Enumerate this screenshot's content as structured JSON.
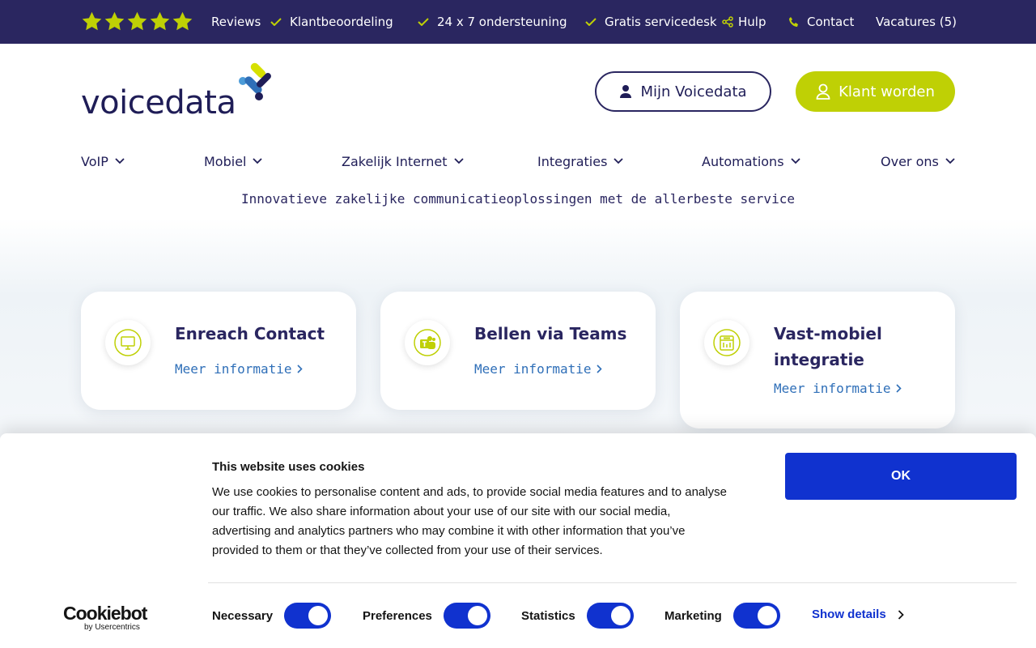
{
  "topbar": {
    "rating_stars": 5,
    "star_color": "#bfd005",
    "reviews": "Reviews",
    "klantbeoordeling": "Klantbeoordeling",
    "ondersteuning": "24 x 7 ondersteuning",
    "servicedesk": "Gratis servicedesk",
    "hulp": "Hulp",
    "contact": "Contact",
    "vacatures": "Vacatures (5)"
  },
  "header": {
    "logo_text": "voicedata",
    "mijn_label": "Mijn Voicedata",
    "klant_label": "Klant worden",
    "accent_color": "#bfd005",
    "brand_color": "#2a2660"
  },
  "nav": {
    "items": [
      {
        "label": "VoIP"
      },
      {
        "label": "Mobiel"
      },
      {
        "label": "Zakelijk Internet"
      },
      {
        "label": "Integraties"
      },
      {
        "label": "Automations"
      },
      {
        "label": "Over ons"
      }
    ]
  },
  "hero": {
    "tagline": "Innovatieve zakelijke communicatieoplossingen met de allerbeste service"
  },
  "cards": [
    {
      "title": "Enreach Contact",
      "link": "Meer informatie",
      "icon": "monitor-icon"
    },
    {
      "title": "Bellen via Teams",
      "link": "Meer informatie",
      "icon": "teams-icon"
    },
    {
      "title": "Vast-mobiel integratie",
      "link": "Meer informatie",
      "icon": "phone-integration-icon"
    }
  ],
  "cookie": {
    "title": "This website uses cookies",
    "text": "We use cookies to personalise content and ads, to provide social media features and to analyse our traffic. We also share information about your use of our site with our social media, advertising and analytics partners who may combine it with other information that you’ve provided to them or that they’ve collected from your use of their services.",
    "ok_label": "OK",
    "brand_main": "Cookiebot",
    "brand_sub": "by Usercentrics",
    "toggles": [
      {
        "label": "Necessary",
        "on": true
      },
      {
        "label": "Preferences",
        "on": true
      },
      {
        "label": "Statistics",
        "on": true
      },
      {
        "label": "Marketing",
        "on": true
      }
    ],
    "show_details": "Show details",
    "button_color": "#1032cf"
  }
}
